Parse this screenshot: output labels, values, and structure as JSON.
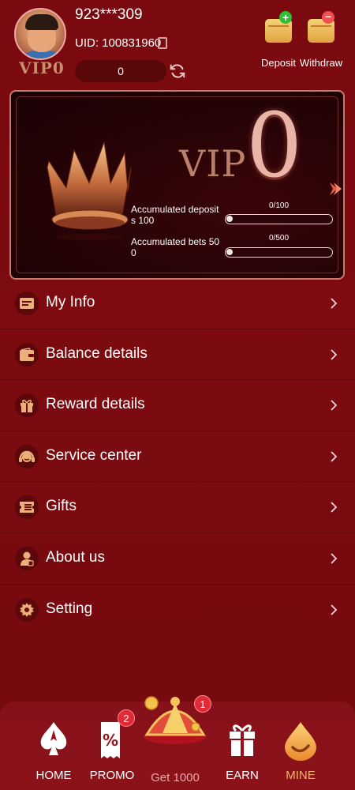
{
  "profile": {
    "phone": "923***309",
    "uid": "UID: 100831960",
    "vip_badge": "VIP0",
    "balance": "0"
  },
  "actions": {
    "deposit_label": "Deposit",
    "withdraw_label": "Withdraw"
  },
  "vip_card": {
    "title": "VIP",
    "level": "0",
    "deposit_label_line1": "Accumulated deposit",
    "deposit_label_line2": "s 100",
    "deposit_progress_text": "0/100",
    "deposit_progress": 0,
    "bets_label_line1": "Accumulated bets 50",
    "bets_label_line2": "0",
    "bets_progress_text": "0/500",
    "bets_progress": 0
  },
  "menu": [
    {
      "label": "My Info",
      "icon": "id-card-icon"
    },
    {
      "label": "Balance details",
      "icon": "wallet-icon"
    },
    {
      "label": "Reward details",
      "icon": "gift-box-icon"
    },
    {
      "label": "Service center",
      "icon": "headset-icon"
    },
    {
      "label": "Gifts",
      "icon": "ticket-icon"
    },
    {
      "label": "About us",
      "icon": "person-icon"
    },
    {
      "label": "Setting",
      "icon": "gear-icon"
    }
  ],
  "bottom_nav": {
    "home": "HOME",
    "promo": "PROMO",
    "promo_badge": "2",
    "get": "Get 1000",
    "get_badge": "1",
    "earn": "EARN",
    "mine": "MINE"
  },
  "colors": {
    "background": "#7a0a0f",
    "active_tab": "#f0b56a",
    "badge": "#e22a36"
  }
}
